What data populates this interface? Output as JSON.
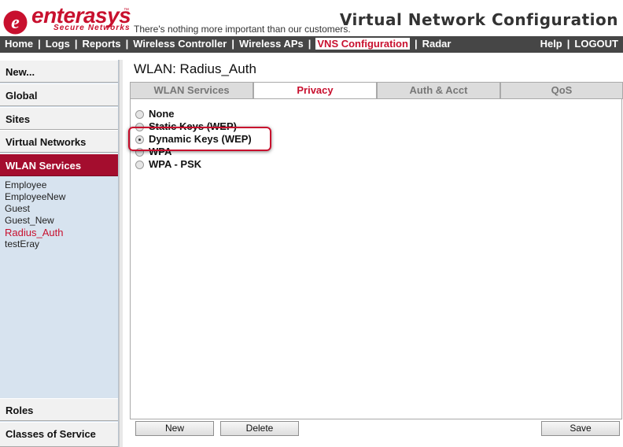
{
  "header": {
    "logo_text": "enterasys",
    "logo_subtext": "Secure Networks",
    "logo_tm": "™",
    "tagline": "There's nothing more important than our customers.",
    "page_title": "Virtual Network Configuration",
    "brand_color": "#c8102e"
  },
  "nav": {
    "items": [
      {
        "label": "Home"
      },
      {
        "label": "Logs"
      },
      {
        "label": "Reports"
      },
      {
        "label": "Wireless Controller"
      },
      {
        "label": "Wireless APs"
      },
      {
        "label": "VNS Configuration",
        "active": true
      },
      {
        "label": "Radar"
      }
    ],
    "right_items": [
      {
        "label": "Help"
      },
      {
        "label": "LOGOUT"
      }
    ],
    "separator": "|"
  },
  "sidebar": {
    "top_buttons": [
      {
        "label": "New..."
      },
      {
        "label": "Global"
      },
      {
        "label": "Sites"
      },
      {
        "label": "Virtual Networks"
      },
      {
        "label": "WLAN Services",
        "active": true
      }
    ],
    "wlan_items": [
      {
        "label": "Employee"
      },
      {
        "label": "EmployeeNew"
      },
      {
        "label": "Guest"
      },
      {
        "label": "Guest_New"
      },
      {
        "label": "Radius_Auth",
        "selected": true
      },
      {
        "label": "testEray"
      }
    ],
    "bottom_buttons": [
      {
        "label": "Roles"
      },
      {
        "label": "Classes of Service"
      }
    ]
  },
  "main": {
    "title": "WLAN: Radius_Auth",
    "tabs": [
      {
        "label": "WLAN Services"
      },
      {
        "label": "Privacy",
        "active": true
      },
      {
        "label": "Auth & Acct"
      },
      {
        "label": "QoS"
      }
    ],
    "privacy_options": [
      {
        "label": "None",
        "checked": false
      },
      {
        "label": "Static Keys (WEP)",
        "checked": false
      },
      {
        "label": "Dynamic Keys (WEP)",
        "checked": true
      },
      {
        "label": "WPA",
        "checked": false
      },
      {
        "label": "WPA - PSK",
        "checked": false
      }
    ]
  },
  "buttons": {
    "new": "New",
    "delete": "Delete",
    "save": "Save"
  }
}
